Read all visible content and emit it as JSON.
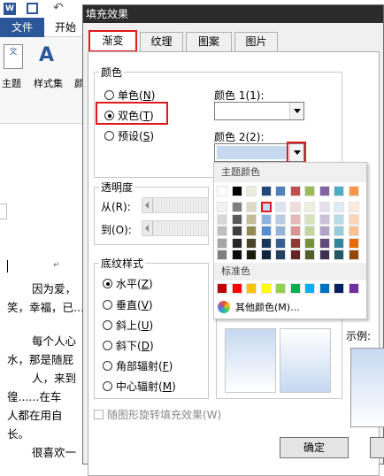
{
  "word": {
    "tab_file": "文件",
    "tab_start": "开始",
    "ribbon_theme": "主题",
    "ribbon_styles": "样式集",
    "ribbon_cut": "颜",
    "doc_lines": [
      "因为爱，",
      "笑，幸福，已...",
      "每个人心",
      "水，那是随屁",
      "人，来到",
      "徨......在车",
      "人都在用自",
      "长。",
      "很喜欢一"
    ]
  },
  "dialog": {
    "title": "填充效果",
    "tabs": [
      "渐变",
      "纹理",
      "图案",
      "图片"
    ],
    "colors_group": {
      "legend": "颜色",
      "options": [
        {
          "label": "单色",
          "key": "N"
        },
        {
          "label": "双色",
          "key": "T"
        },
        {
          "label": "预设",
          "key": "S"
        }
      ],
      "color1_label": "颜色 1(1):",
      "color2_label": "颜色 2(2):",
      "color2_value_hex": "#c6d9f1"
    },
    "transparency_group": {
      "legend": "透明度",
      "from_label": "从(R):",
      "to_label": "到(O):"
    },
    "shading_group": {
      "legend": "底纹样式",
      "options": [
        {
          "label": "水平",
          "key": "Z"
        },
        {
          "label": "垂直",
          "key": "V"
        },
        {
          "label": "斜上",
          "key": "U"
        },
        {
          "label": "斜下",
          "key": "D"
        },
        {
          "label": "角部辐射",
          "key": "F"
        },
        {
          "label": "中心辐射",
          "key": "M"
        }
      ]
    },
    "sample_label": "示例:",
    "rotate_checkbox": "随图形旋转填充效果(W)",
    "ok_button": "确定"
  },
  "color_popup": {
    "theme_header": "主题颜色",
    "theme_row": [
      "#ffffff",
      "#000000",
      "#eeece1",
      "#1f497d",
      "#4f81bd",
      "#c0504d",
      "#9bbb59",
      "#8064a2",
      "#4bacc6",
      "#f79646"
    ],
    "theme_columns": [
      [
        "#f2f2f2",
        "#d8d8d8",
        "#bfbfbf",
        "#a5a5a5",
        "#7f7f7f"
      ],
      [
        "#7f7f7f",
        "#595959",
        "#3f3f3f",
        "#262626",
        "#0c0c0c"
      ],
      [
        "#ddd9c3",
        "#c4bd97",
        "#938953",
        "#494429",
        "#1d1b10"
      ],
      [
        "#c6d9f0",
        "#8db3e2",
        "#548dd4",
        "#17365d",
        "#0f243e"
      ],
      [
        "#dbe5f1",
        "#b8cce4",
        "#95b3d7",
        "#366092",
        "#244061"
      ],
      [
        "#f2dcdb",
        "#e5b9b7",
        "#d99694",
        "#953734",
        "#632423"
      ],
      [
        "#ebf1dd",
        "#d7e3bc",
        "#c3d69b",
        "#76923c",
        "#4f6128"
      ],
      [
        "#e5e0ec",
        "#ccc1d9",
        "#b2a2c7",
        "#5f497a",
        "#3f3151"
      ],
      [
        "#dbeef3",
        "#b7dde8",
        "#92cddc",
        "#31859b",
        "#205867"
      ],
      [
        "#fdeada",
        "#fbd5b5",
        "#fac08f",
        "#e36c09",
        "#974806"
      ]
    ],
    "standard_header": "标准色",
    "standard_row": [
      "#c00000",
      "#ff0000",
      "#ffc000",
      "#ffff00",
      "#92d050",
      "#00b050",
      "#00b0f0",
      "#0070c0",
      "#002060",
      "#7030a0"
    ],
    "more_colors": "其他颜色(M)..."
  }
}
